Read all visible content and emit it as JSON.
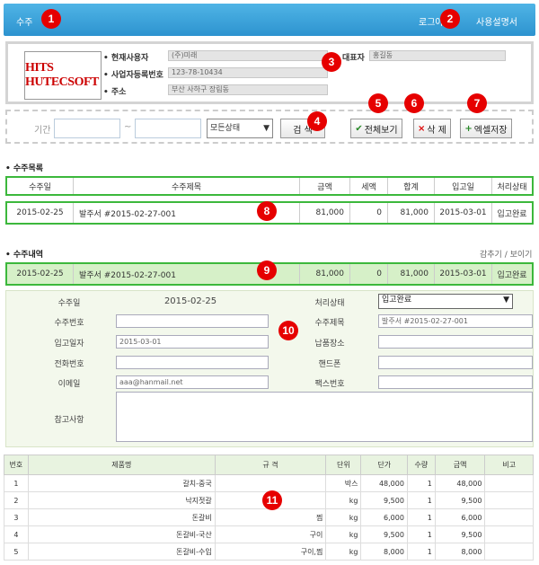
{
  "header": {
    "title": "수주",
    "login_label": "로그아웃",
    "manual_label": "사용설명서"
  },
  "company": {
    "logo_text": "HITS HUTECSOFT",
    "current_user_label": "현재사용자",
    "current_user_value": "(주)미래",
    "ceo_label": "대표자",
    "ceo_value": "홍길동",
    "biz_no_label": "사업자등록번호",
    "biz_no_value": "123-78-10434",
    "address_label": "주소",
    "address_value": "부산 사하구 장림동"
  },
  "search": {
    "period_label": "기간 :",
    "tilde": "~",
    "status_select": "모든상태",
    "search_button": "검 색",
    "view_all_button": "전체보기",
    "delete_button": "삭 제",
    "excel_button": "엑셀저장"
  },
  "order_list": {
    "title": "• 수주목록",
    "columns": [
      "수주일",
      "수주제목",
      "금액",
      "세액",
      "합계",
      "입고일",
      "처리상태"
    ],
    "row": [
      "2015-02-25",
      "발주서 #2015-02-27-001",
      "81,000",
      "0",
      "81,000",
      "2015-03-01",
      "입고완료"
    ]
  },
  "order_detail": {
    "title": "• 수주내역",
    "toggle_label": "감추기 / 보이기",
    "row": [
      "2015-02-25",
      "발주서 #2015-02-27-001",
      "81,000",
      "0",
      "81,000",
      "2015-03-01",
      "입고완료"
    ]
  },
  "form": {
    "order_date_label": "수주일",
    "order_date_value": "2015-02-25",
    "status_label": "처리상태",
    "status_value": "입고완료",
    "order_no_label": "수주번호",
    "order_no_value": "",
    "order_title_label": "수주제목",
    "order_title_value": "발주서 #2015-02-27-001",
    "in_date_label": "입고일자",
    "in_date_value": "2015-03-01",
    "delivery_label": "납품장소",
    "delivery_value": "",
    "phone_label": "전화번호",
    "phone_value": "",
    "mobile_label": "핸드폰",
    "mobile_value": "",
    "email_label": "이메일",
    "email_value": "aaa@hanmail.net",
    "fax_label": "팩스번호",
    "fax_value": "",
    "note_label": "참고사항",
    "note_value": ""
  },
  "items": {
    "columns": [
      "번호",
      "제품명",
      "규 격",
      "단위",
      "단가",
      "수량",
      "금액",
      "비고"
    ],
    "rows": [
      [
        "1",
        "갈치-중국",
        "",
        "박스",
        "48,000",
        "1",
        "48,000",
        ""
      ],
      [
        "2",
        "낙지젓갈",
        "",
        "kg",
        "9,500",
        "1",
        "9,500",
        ""
      ],
      [
        "3",
        "돈갈비",
        "찜",
        "kg",
        "6,000",
        "1",
        "6,000",
        ""
      ],
      [
        "4",
        "돈갈비-국산",
        "구이",
        "kg",
        "9,500",
        "1",
        "9,500",
        ""
      ],
      [
        "5",
        "돈갈비-수입",
        "구이,찜",
        "kg",
        "8,000",
        "1",
        "8,000",
        ""
      ]
    ]
  },
  "markers": [
    "1",
    "2",
    "3",
    "4",
    "5",
    "6",
    "7",
    "8",
    "9",
    "10",
    "11"
  ],
  "colors": {
    "header": "#2d93cf",
    "marker": "#e60000",
    "highlight_border": "#3cb83c",
    "detail_row": "#d6f0c8"
  }
}
